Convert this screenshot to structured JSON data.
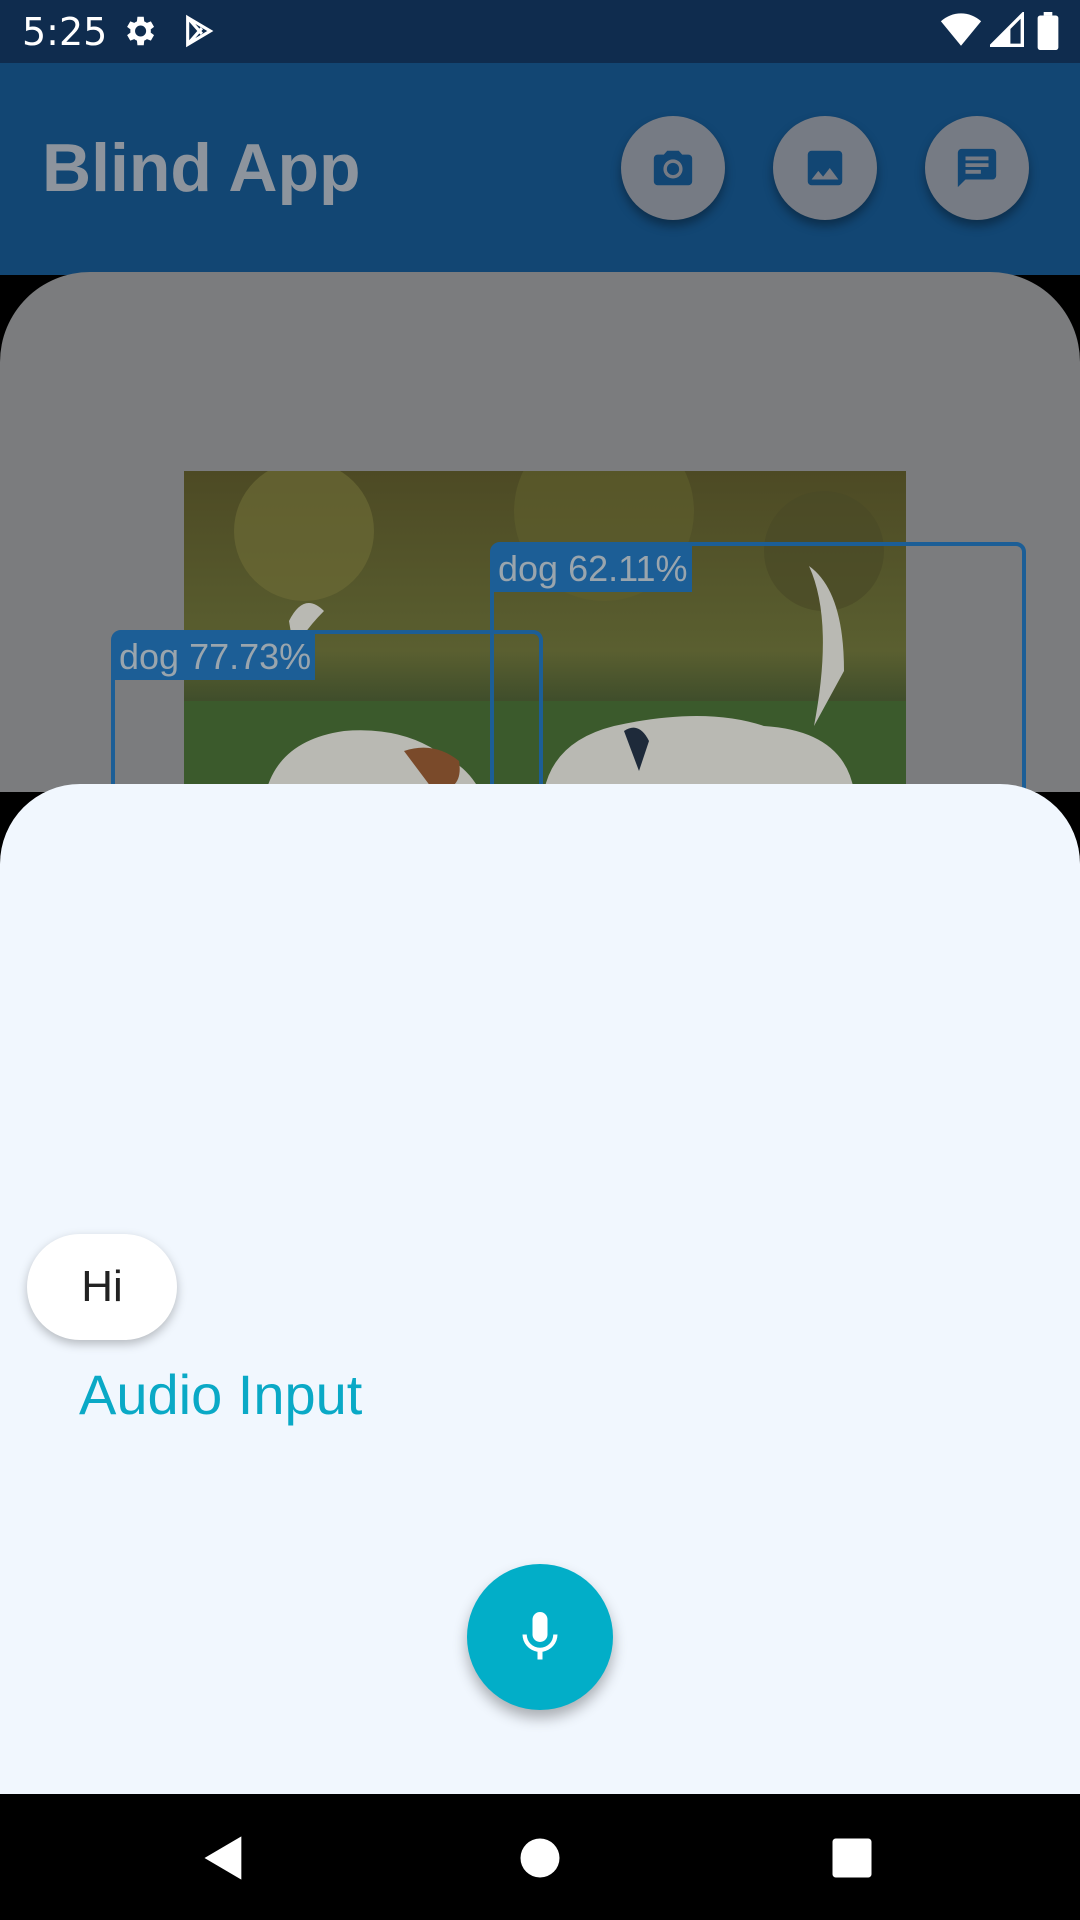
{
  "status_bar": {
    "time": "5:25",
    "icons": [
      "gear-icon",
      "play-store-icon",
      "wifi-icon",
      "signal-icon",
      "battery-icon"
    ]
  },
  "app_bar": {
    "title": "Blind App",
    "actions": [
      "camera-icon",
      "image-icon",
      "chat-icon"
    ]
  },
  "detections": [
    {
      "label": "dog 77.73%"
    },
    {
      "label": "dog 62.11%"
    }
  ],
  "sheet": {
    "chip_text": "Hi",
    "audio_label": "Audio Input",
    "mic_icon": "mic-icon"
  },
  "nav_bar": {
    "buttons": [
      "back-icon",
      "home-icon",
      "recents-icon"
    ]
  },
  "colors": {
    "app_bar": "#124673",
    "accent": "#02aec8",
    "detection_box": "#1c5e96",
    "sheet": "#f1f7fe"
  }
}
